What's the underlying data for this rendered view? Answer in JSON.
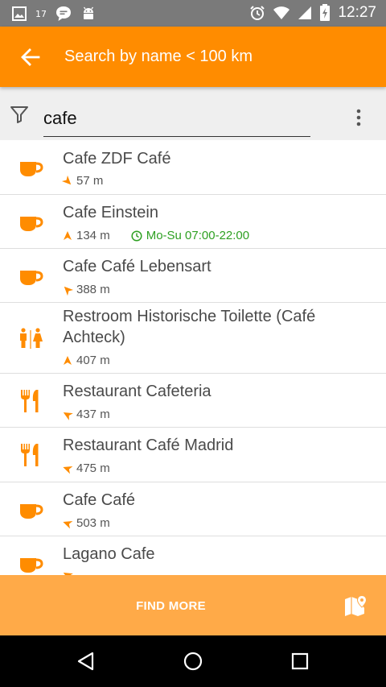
{
  "status_bar": {
    "time": "12:27",
    "notification_count": "17",
    "icons": [
      "image-icon",
      "gallery-count-icon",
      "chat-icon",
      "android-icon",
      "alarm-icon",
      "wifi-icon",
      "signal-icon",
      "battery-charging-icon"
    ]
  },
  "toolbar": {
    "title": "Search by name  < 100 km",
    "back_icon": "arrow-back-icon"
  },
  "search": {
    "value": "cafe",
    "filter_icon": "filter-icon",
    "more_icon": "more-vert-icon"
  },
  "results": [
    {
      "name": "Cafe ZDF Café",
      "distance": "57 m",
      "hours": "",
      "icon": "cafe-cup-icon",
      "direction_deg": 135
    },
    {
      "name": "Cafe Einstein",
      "distance": "134 m",
      "hours": "Mo-Su 07:00-22:00",
      "icon": "cafe-cup-icon",
      "direction_deg": 0
    },
    {
      "name": "Cafe Café Lebensart",
      "distance": "388 m",
      "hours": "",
      "icon": "cafe-cup-icon",
      "direction_deg": 315
    },
    {
      "name": "Restroom Historische Toilette (Café Achteck)",
      "distance": "407 m",
      "hours": "",
      "icon": "restroom-icon",
      "direction_deg": 0
    },
    {
      "name": "Restaurant Cafeteria",
      "distance": "437 m",
      "hours": "",
      "icon": "restaurant-fork-knife-icon",
      "direction_deg": 300
    },
    {
      "name": "Restaurant Café Madrid",
      "distance": "475 m",
      "hours": "",
      "icon": "restaurant-fork-knife-icon",
      "direction_deg": 290
    },
    {
      "name": "Cafe Café",
      "distance": "503 m",
      "hours": "",
      "icon": "cafe-cup-icon",
      "direction_deg": 290
    },
    {
      "name": "Lagano Cafe",
      "distance": "",
      "hours": "",
      "icon": "cafe-cup-icon",
      "direction_deg": 300
    }
  ],
  "find_more": {
    "label": "FIND MORE",
    "map_icon": "map-pin-icon"
  },
  "nav_bar": {
    "icons": [
      "nav-back-icon",
      "nav-home-icon",
      "nav-recents-icon"
    ]
  },
  "colors": {
    "accent": "#ff8c00",
    "find_more_bg": "#ffaa48",
    "hours_green": "#2ea022",
    "status_bar": "#7a7a7a"
  }
}
